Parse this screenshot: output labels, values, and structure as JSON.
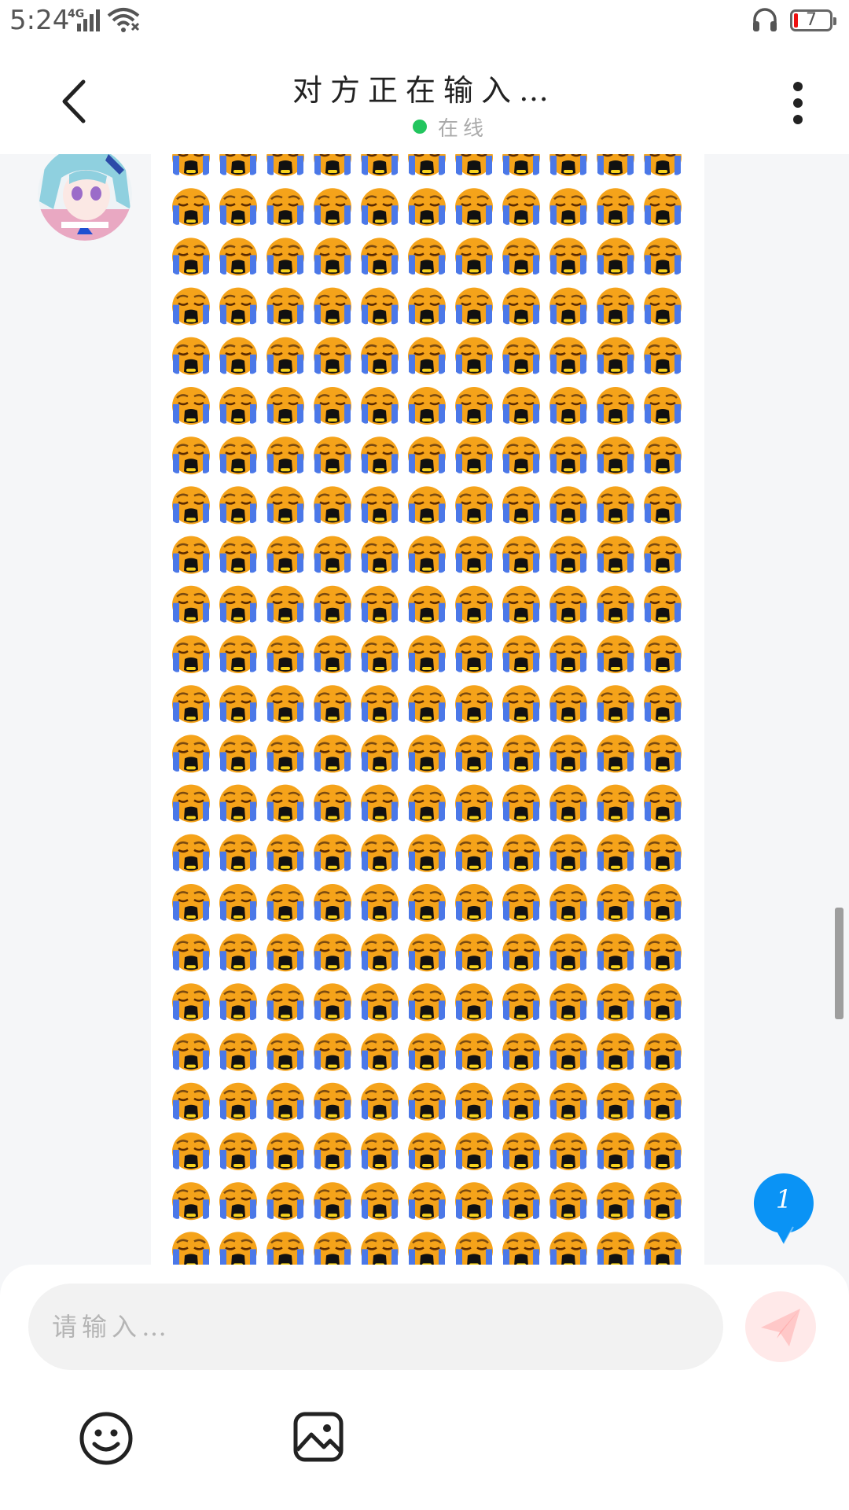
{
  "status_bar": {
    "time": "5:24",
    "network": "4G",
    "battery_level": "7",
    "icons": [
      "signal-icon",
      "wifi-icon",
      "headset-icon",
      "battery-icon"
    ]
  },
  "header": {
    "title": "对方正在输入…",
    "status": "在线",
    "status_color": "#22c55e",
    "icons": [
      "back-arrow-icon",
      "more-vertical-icon"
    ]
  },
  "chat": {
    "message_emoji": "😭",
    "emoji_columns": 11,
    "emoji_rows": 23,
    "unread_count": "1",
    "accent_color": "#0a93f5"
  },
  "composer": {
    "placeholder": "请输入…",
    "value": "",
    "icons": [
      "send-icon",
      "emoji-icon",
      "image-icon"
    ]
  }
}
